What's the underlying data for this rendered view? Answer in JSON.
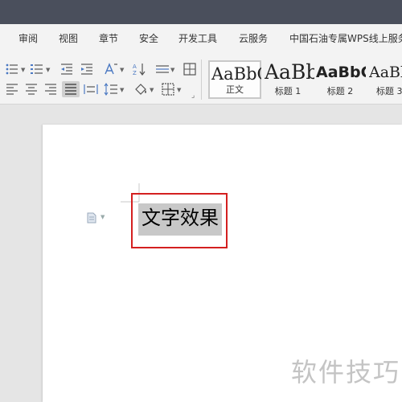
{
  "menu": {
    "items": [
      "审阅",
      "视图",
      "章节",
      "安全",
      "开发工具",
      "云服务",
      "中国石油专属WPS线上服务"
    ]
  },
  "ribbon": {
    "styles": [
      {
        "sample": "AaBbCcDd",
        "name": "正文"
      },
      {
        "sample": "AaBb",
        "name": "标题 1"
      },
      {
        "sample": "AaBbC",
        "name": "标题 2"
      },
      {
        "sample": "AaBbC",
        "name": "标题 3"
      }
    ]
  },
  "document": {
    "selected_text": "文字效果"
  },
  "watermark": {
    "text": "软件技巧"
  },
  "colors": {
    "titlebar": "#4a4f5c",
    "highlight_border": "#d42020",
    "selection": "#c8c8c8",
    "active_button": "#cfcfcf"
  }
}
